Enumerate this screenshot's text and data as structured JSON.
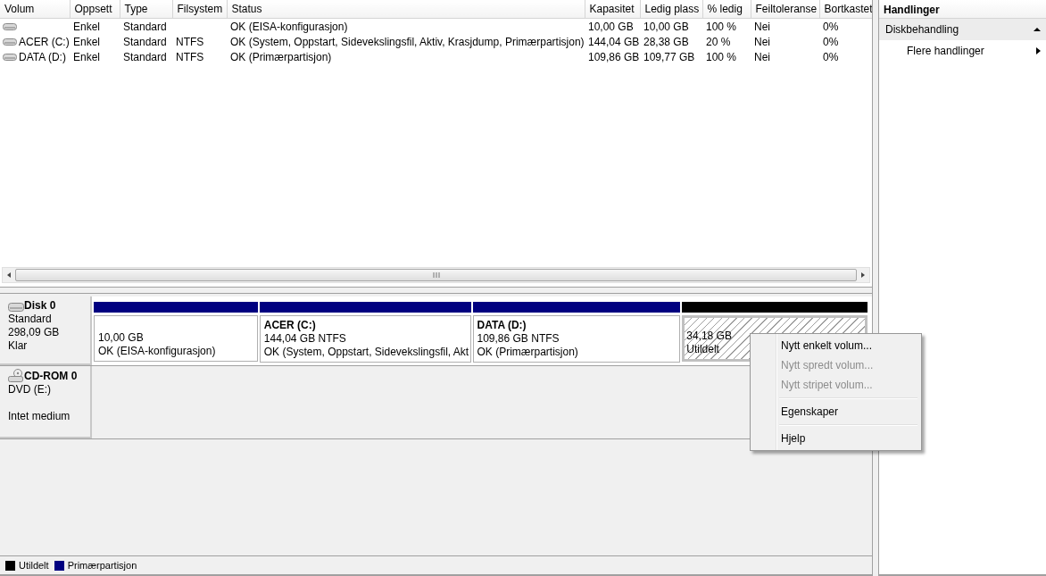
{
  "volume_table": {
    "columns": [
      "Volum",
      "Oppsett",
      "Type",
      "Filsystem",
      "Status",
      "Kapasitet",
      "Ledig plass",
      "% ledig",
      "Feiltoleranse",
      "Bortkastet"
    ],
    "rows": [
      {
        "cells": [
          "",
          "Enkel",
          "Standard",
          "",
          "OK (EISA-konfigurasjon)",
          "10,00 GB",
          "10,00 GB",
          "100 %",
          "Nei",
          "0%"
        ]
      },
      {
        "cells": [
          "ACER (C:)",
          "Enkel",
          "Standard",
          "NTFS",
          "OK (System, Oppstart, Sidevekslingsfil, Aktiv, Krasjdump, Primærpartisjon)",
          "144,04 GB",
          "28,38 GB",
          "20 %",
          "Nei",
          "0%"
        ]
      },
      {
        "cells": [
          "DATA (D:)",
          "Enkel",
          "Standard",
          "NTFS",
          "OK (Primærpartisjon)",
          "109,86 GB",
          "109,77 GB",
          "100 %",
          "Nei",
          "0%"
        ]
      }
    ]
  },
  "disks": [
    {
      "kind": "disk",
      "name": "Disk 0",
      "type": "Standard",
      "size": "298,09 GB",
      "status": "Klar",
      "partitions": [
        {
          "kind": "primary",
          "size": "10,00 GB",
          "status": "OK (EISA-konfigurasjon)"
        },
        {
          "kind": "primary",
          "title": "ACER  (C:)",
          "size": "144,04 GB NTFS",
          "status": "OK (System, Oppstart, Sidevekslingsfil, Akt"
        },
        {
          "kind": "primary",
          "title": "DATA  (D:)",
          "size": "109,86 GB NTFS",
          "status": "OK (Primærpartisjon)"
        },
        {
          "kind": "unallocated",
          "size": "34,18 GB",
          "status": "Utildelt"
        }
      ]
    },
    {
      "kind": "cdrom",
      "name": "CD-ROM 0",
      "type": "DVD (E:)",
      "status": "Intet medium"
    }
  ],
  "legend": [
    {
      "label": "Utildelt",
      "color": "#000000"
    },
    {
      "label": "Primærpartisjon",
      "color": "#000080"
    }
  ],
  "actions": {
    "title": "Handlinger",
    "sections": [
      {
        "label": "Diskbehandling",
        "expanded": true,
        "items": [
          {
            "label": "Flere handlinger"
          }
        ]
      }
    ]
  },
  "context_menu": {
    "groups": [
      {
        "items": [
          {
            "label": "Nytt enkelt volum...",
            "disabled": false
          },
          {
            "label": "Nytt spredt volum...",
            "disabled": true
          },
          {
            "label": "Nytt stripet volum...",
            "disabled": true
          }
        ]
      },
      {
        "items": [
          {
            "label": "Egenskaper",
            "disabled": false
          }
        ]
      },
      {
        "items": [
          {
            "label": "Hjelp",
            "disabled": false
          }
        ]
      }
    ]
  }
}
